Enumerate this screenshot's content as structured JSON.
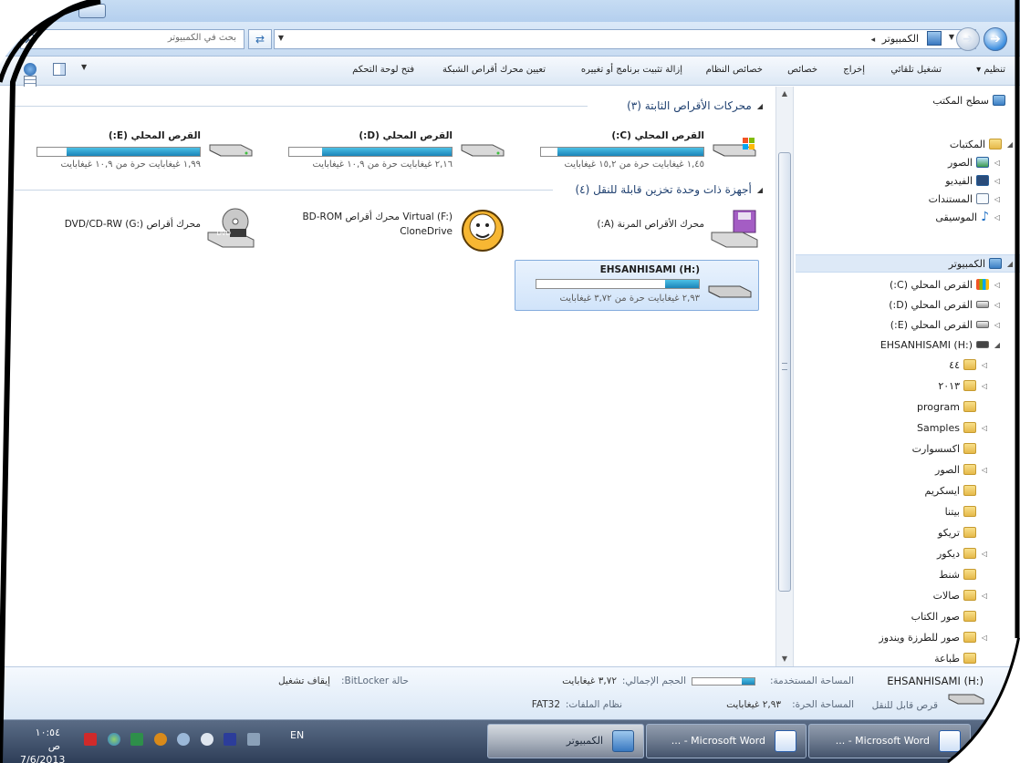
{
  "window": {
    "address_path": "الكمبيوتر",
    "search_placeholder": "بحث في الكمبيوتر"
  },
  "toolbar": {
    "organize": "تنظيم ▾",
    "autoplay": "تشغيل تلقائي",
    "eject": "إخراج",
    "properties": "خصائص",
    "system_properties": "خصائص النظام",
    "uninstall": "إزالة تثبيت برنامج أو تغييره",
    "map_drive": "تعيين محرك أقراص الشبكة",
    "control_panel": "فتح لوحة التحكم"
  },
  "nav": {
    "desktop": "سطح المكتب",
    "libraries": "المكتبات",
    "pictures": "الصور",
    "video": "الفيديو",
    "documents": "المستندات",
    "music": "الموسيقى",
    "computer": "الكمبيوتر",
    "drive_c": "القرص المحلي (C:)",
    "drive_d": "القرص المحلي (D:)",
    "drive_e": "القرص المحلي (E:)",
    "drive_h": "EHSANHISAMI (H:)",
    "folders": [
      "٤٤",
      "٢٠١٣",
      "program",
      "Samples",
      "اكسسوارت",
      "الصور",
      "ايسكريم",
      "بيتنا",
      "تريكو",
      "ديكور",
      "شنط",
      "صالات",
      "صور الكتاب",
      "صور للطرزة ويندوز",
      "طباعة"
    ]
  },
  "content": {
    "hdd_group": "محركات الأقراص الثابتة (٣)",
    "removable_group": "أجهزة ذات وحدة تخزين قابلة للنقل (٤)",
    "drives": [
      {
        "name": "القرص المحلي (C:)",
        "free": "١,٤٥ غيغابايت حرة من ١٥,٢ غيغابايت",
        "used_fraction": 0.9
      },
      {
        "name": "القرص المحلي (D:)",
        "free": "٢,١٦ غيغابايت حرة من ١٠,٩ غيغابايت",
        "used_fraction": 0.8
      },
      {
        "name": "القرص المحلي (E:)",
        "free": "١,٩٩ غيغابايت حرة من ١٠,٩ غيغابايت",
        "used_fraction": 0.82
      }
    ],
    "floppy": "محرك الأقراص المرنة (A:)",
    "virtual_drive_1": "Virtual (F:) محرك أقراص BD-ROM",
    "virtual_drive_2": "CloneDrive",
    "dvd_drive": "محرك أقراص DVD/CD-RW (G:)",
    "usb": {
      "name": "EHSANHISAMI (H:)",
      "free": "٢,٩٣ غيغابايت حرة من ٣,٧٢ غيغابايت",
      "used_fraction": 0.21
    }
  },
  "details": {
    "title": "EHSANHISAMI (H:)",
    "type": "قرص قابل للنقل",
    "used_label": "المساحة المستخدمة:",
    "total_label": "الحجم الإجمالي:",
    "total_value": "٣,٧٢ غيغابايت",
    "free_label": "المساحة الحرة:",
    "free_value": "٢,٩٣ غيغابايت",
    "fs_label": "نظام الملفات:",
    "fs_value": "FAT32",
    "bitlocker_label": "حالة BitLocker:",
    "bitlocker_value": "إيقاف تشغيل",
    "used_fraction": 0.21
  },
  "taskbar": {
    "btn1": "Microsoft Word - ...",
    "btn2": "Microsoft Word - ...",
    "btn3": "الكمبيوتر",
    "lang": "EN",
    "time": "١٠:٥٤ ص",
    "date": "7/6/2013"
  },
  "colors": {
    "accent": "#1b84b8",
    "selection": "#d1e4fa"
  }
}
